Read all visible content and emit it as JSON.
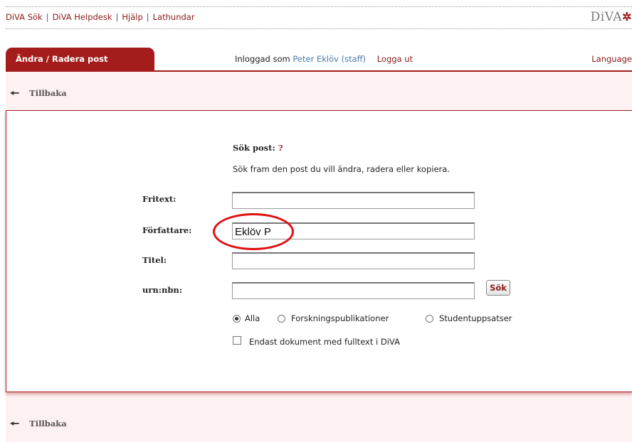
{
  "top_links": [
    "DiVA Sök",
    "DiVA Helpdesk",
    "Hjälp",
    "Lathundar"
  ],
  "logo_text": "DiVA",
  "logo_symbol": "✲",
  "active_tab": "Ändra / Radera post",
  "user": {
    "prefix": "Inloggad som",
    "name": "Peter Eklöv (staff)",
    "logout": "Logga ut"
  },
  "language_link": "Language",
  "back_label": "Tillbaka",
  "form": {
    "title": "Sök post:",
    "help": "?",
    "description": "Sök fram den post du vill ändra, radera eller kopiera.",
    "fields": {
      "fritext": {
        "label": "Fritext:",
        "value": ""
      },
      "forfattare": {
        "label": "Författare:",
        "value": "Eklöv P"
      },
      "titel": {
        "label": "Titel:",
        "value": ""
      },
      "urn": {
        "label": "urn:nbn:",
        "value": ""
      }
    },
    "search_button": "Sök",
    "radios": [
      {
        "label": "Alla",
        "selected": true
      },
      {
        "label": "Forskningspublikationer",
        "selected": false
      },
      {
        "label": "Studentuppsatser",
        "selected": false
      }
    ],
    "checkbox": {
      "label": "Endast dokument med fulltext i DiVA",
      "checked": false
    }
  },
  "colors": {
    "brand": "#a51c1c",
    "link": "#8a1a1a",
    "user": "#4a78b0",
    "annotation": "#e01010",
    "pink_bg": "#fdf1f1"
  }
}
